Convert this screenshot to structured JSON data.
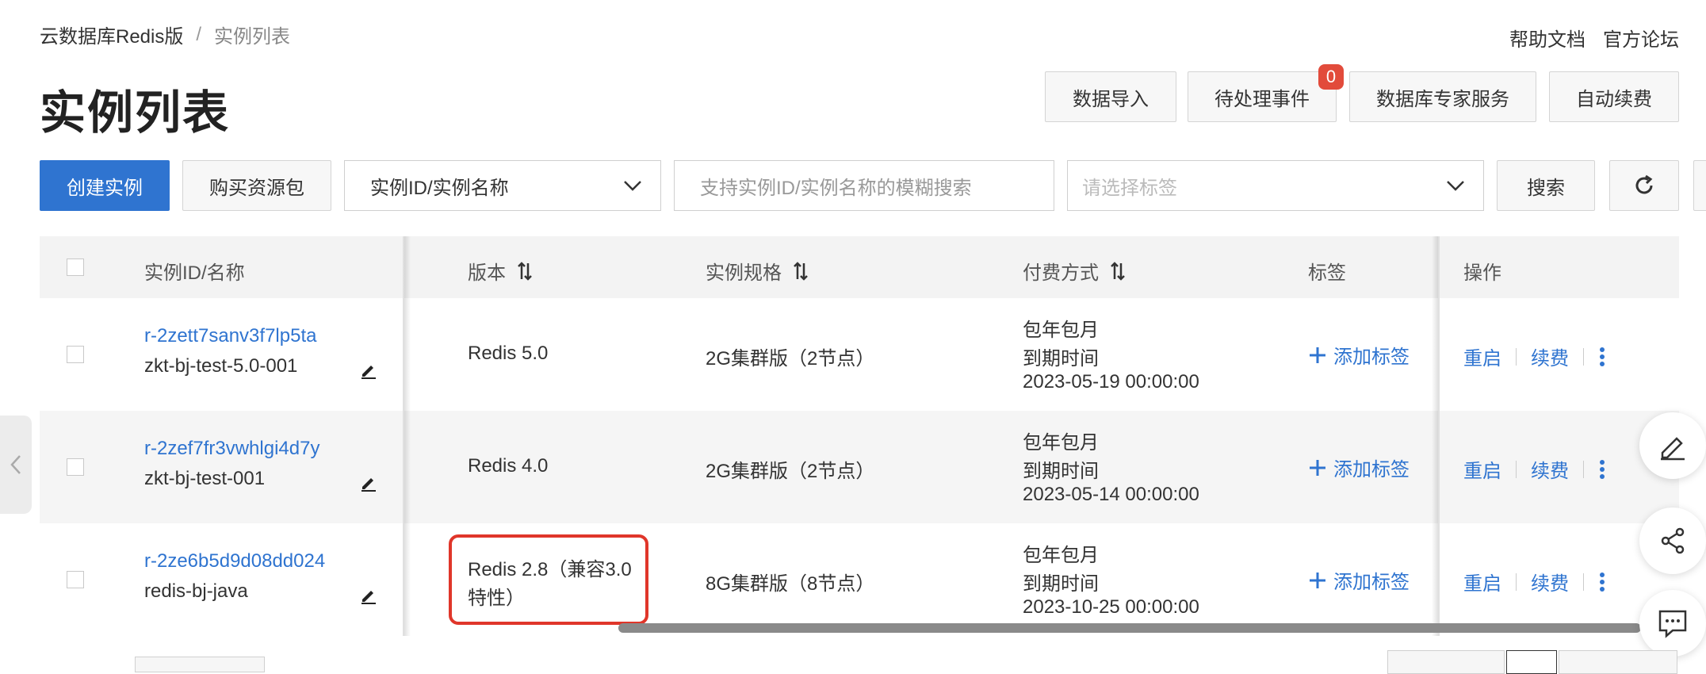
{
  "breadcrumb": {
    "root": "云数据库Redis版",
    "separator": "/",
    "current": "实例列表"
  },
  "top_links": {
    "help": "帮助文档",
    "forum": "官方论坛"
  },
  "page_title": "实例列表",
  "header_buttons": {
    "import": "数据导入",
    "pending": "待处理事件",
    "pending_badge": "0",
    "expert": "数据库专家服务",
    "auto_renew": "自动续费"
  },
  "toolbar": {
    "create": "创建实例",
    "buy_pack": "购买资源包",
    "filter_select": "实例ID/实例名称",
    "search_placeholder": "支持实例ID/实例名称的模糊搜索",
    "tag_placeholder": "请选择标签",
    "search_button": "搜索"
  },
  "table": {
    "headers": {
      "id_name": "实例ID/名称",
      "version": "版本",
      "spec": "实例规格",
      "billing": "付费方式",
      "tags": "标签",
      "actions": "操作"
    },
    "rows": [
      {
        "id": "r-2zett7sanv3f7lp5ta",
        "name": "zkt-bj-test-5.0-001",
        "version": "Redis 5.0",
        "spec": "2G集群版（2节点）",
        "billing": "包年包月",
        "expire_label": "到期时间",
        "expire_time": "2023-05-19 00:00:00",
        "add_tag": "添加标签",
        "restart": "重启",
        "renew": "续费"
      },
      {
        "id": "r-2zef7fr3vwhlgi4d7y",
        "name": "zkt-bj-test-001",
        "version": "Redis 4.0",
        "spec": "2G集群版（2节点）",
        "billing": "包年包月",
        "expire_label": "到期时间",
        "expire_time": "2023-05-14 00:00:00",
        "add_tag": "添加标签",
        "restart": "重启",
        "renew": "续费"
      },
      {
        "id": "r-2ze6b5d9d08dd024",
        "name": "redis-bj-java",
        "version_line1": "Redis 2.8（兼容3.0",
        "version_line2": "特性）",
        "spec": "8G集群版（8节点）",
        "billing": "包年包月",
        "expire_label": "到期时间",
        "expire_time": "2023-10-25 00:00:00",
        "add_tag": "添加标签",
        "restart": "重启",
        "renew": "续费"
      }
    ]
  },
  "colors": {
    "primary": "#2f74d0",
    "badge": "#e24b3b",
    "highlight": "#e0362a"
  }
}
